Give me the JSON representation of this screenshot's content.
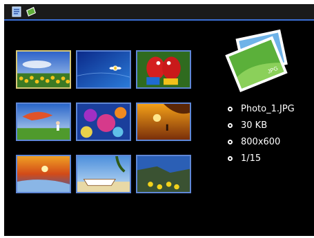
{
  "toolbar": {
    "icons": [
      "document-icon",
      "photo-icon"
    ]
  },
  "preview": {
    "badge": "JPG"
  },
  "thumbnails": [
    {
      "name": "thumb-sunflowers",
      "selected": true
    },
    {
      "name": "thumb-underwater"
    },
    {
      "name": "thumb-parrots"
    },
    {
      "name": "thumb-kite-runner"
    },
    {
      "name": "thumb-coral-reef"
    },
    {
      "name": "thumb-sunset-surfer"
    },
    {
      "name": "thumb-beach-sunset"
    },
    {
      "name": "thumb-boat-beach"
    },
    {
      "name": "thumb-coast-flowers"
    }
  ],
  "file_info": {
    "filename": "Photo_1.JPG",
    "size": "30 KB",
    "resolution": "800x600",
    "index": "1/15"
  },
  "colors": {
    "frame_border": "#5f87d6",
    "selected_border": "#d8c979",
    "accent_line": "#3b6fd6"
  }
}
